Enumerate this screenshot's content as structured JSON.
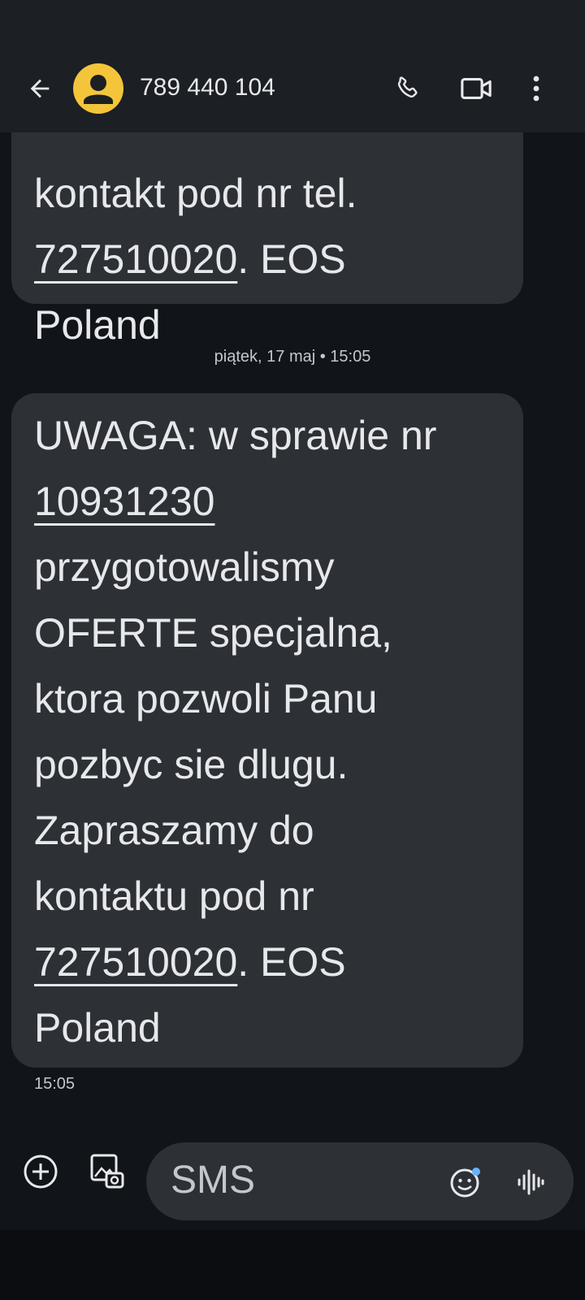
{
  "header": {
    "contact_name": "789 440 104",
    "icons": {
      "back": "back-arrow-icon",
      "avatar": "person-icon",
      "call": "phone-icon",
      "video": "video-camera-icon",
      "menu": "more-vert-icon"
    }
  },
  "messages": {
    "previous_bubble": {
      "lines": [
        "kontakt pod nr tel.",
        "727510020",
        ". EOS",
        "Poland"
      ]
    },
    "date_separator": "piątek, 17 maj • 15:05",
    "main_bubble": {
      "lines": [
        "UWAGA: w sprawie nr",
        "10931230",
        "przygotowalismy",
        "OFERTE specjalna,",
        "ktora pozwoli Panu",
        "pozbyc sie dlugu.",
        "Zapraszamy do",
        "kontaktu pod nr",
        "727510020",
        ". EOS",
        "Poland"
      ],
      "time": "15:05"
    }
  },
  "composer": {
    "placeholder": "SMS",
    "icons": {
      "add": "add-circle-icon",
      "media": "gallery-icon",
      "emoji": "emoji-icon",
      "voice": "voice-waveform-icon"
    }
  },
  "colors": {
    "background": "#111418",
    "topbar": "#1c1f23",
    "bubble": "#2d3035",
    "text": "#e6e8ec",
    "avatar": "#f4c53a",
    "badge_dot": "#6ab3ff"
  }
}
